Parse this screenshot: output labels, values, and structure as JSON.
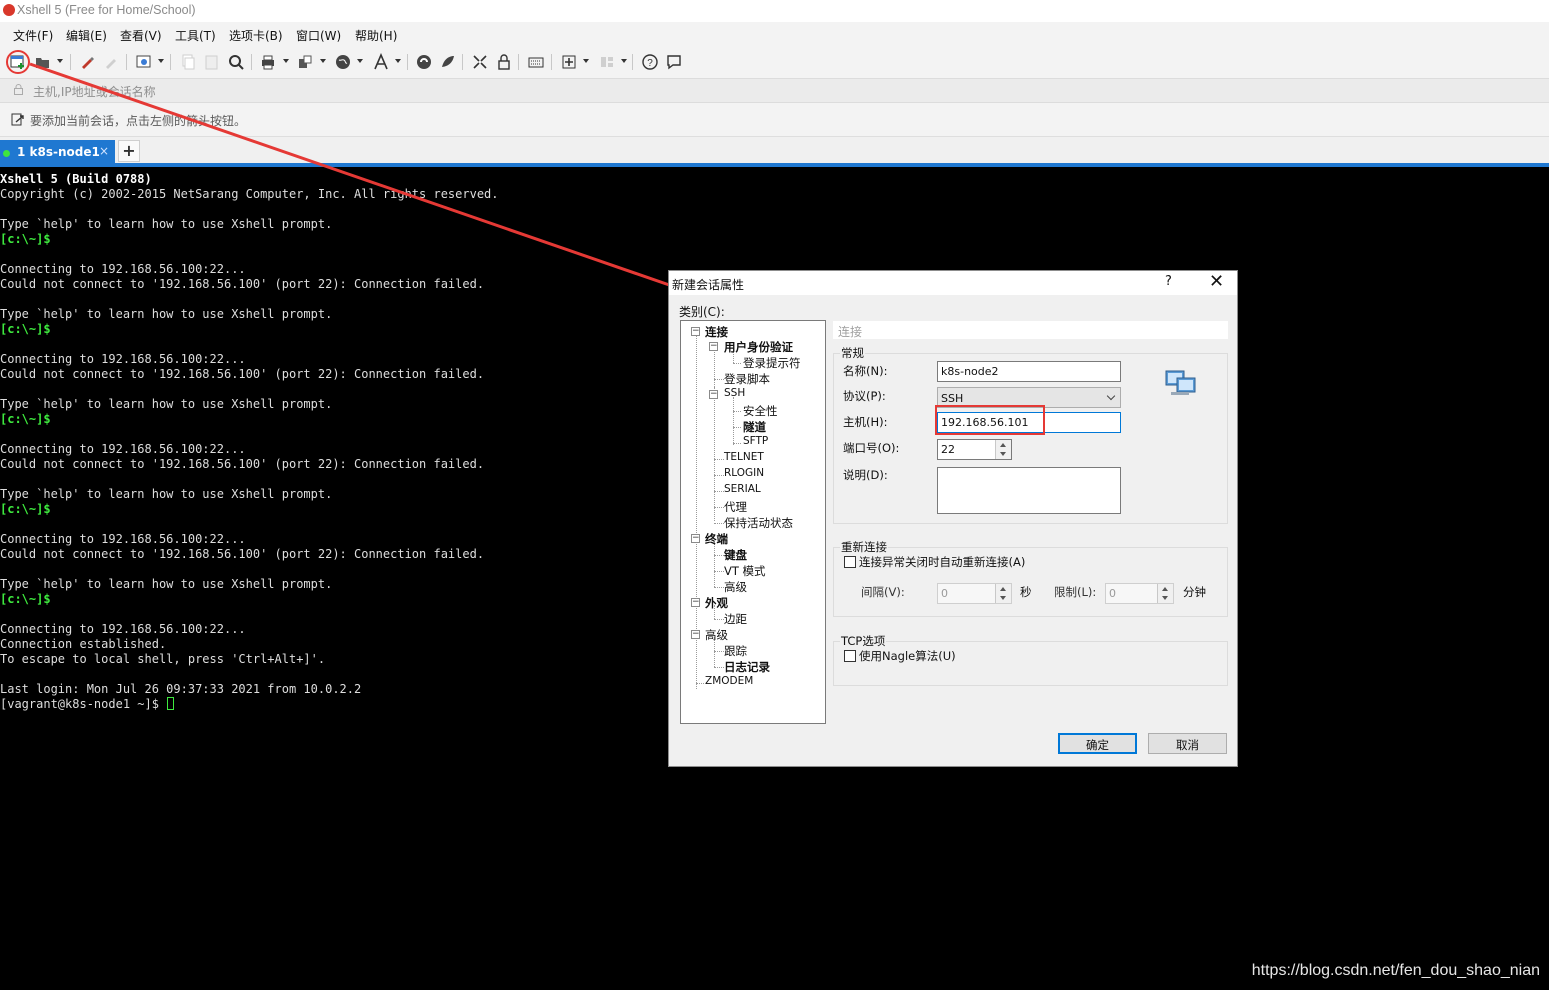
{
  "window": {
    "title": "Xshell 5 (Free for Home/School)"
  },
  "menu": [
    "文件(F)",
    "编辑(E)",
    "查看(V)",
    "工具(T)",
    "选项卡(B)",
    "窗口(W)",
    "帮助(H)"
  ],
  "toolbar": {
    "icons": [
      "new-session-icon",
      "open-folder-icon",
      "reconnect-icon",
      "disconnect-icon",
      "properties-icon",
      "copy-icon",
      "paste-icon",
      "find-icon",
      "print-icon",
      "transfer-icon",
      "globe-icon",
      "font-icon",
      "xftp-icon",
      "xmanager-icon",
      "fullscreen-icon",
      "lock-icon",
      "keyboard-icon",
      "add-tab-icon",
      "layout-icon",
      "help-icon",
      "chat-icon"
    ]
  },
  "address": {
    "placeholder": "主机,IP地址或会话名称"
  },
  "session_bar": {
    "hint": "要添加当前会话，点击左侧的箭头按钮。"
  },
  "tabs": [
    {
      "label": "1 k8s-node1",
      "close": "×",
      "status_color": "#3fe53f"
    }
  ],
  "add_tab": "+",
  "terminal": {
    "lines": [
      {
        "text": "Xshell 5 (Build 0788)",
        "style": "bold"
      },
      {
        "text": "Copyright (c) 2002-2015 NetSarang Computer, Inc. All rights reserved.",
        "style": "normal"
      },
      {
        "text": "",
        "style": "normal"
      },
      {
        "text": "Type `help' to learn how to use Xshell prompt.",
        "style": "normal"
      },
      {
        "text": "[c:\\~]$",
        "style": "prompt"
      },
      {
        "text": "",
        "style": "normal"
      },
      {
        "text": "Connecting to 192.168.56.100:22...",
        "style": "normal"
      },
      {
        "text": "Could not connect to '192.168.56.100' (port 22): Connection failed.",
        "style": "normal"
      },
      {
        "text": "",
        "style": "normal"
      },
      {
        "text": "Type `help' to learn how to use Xshell prompt.",
        "style": "normal"
      },
      {
        "text": "[c:\\~]$",
        "style": "prompt"
      },
      {
        "text": "",
        "style": "normal"
      },
      {
        "text": "Connecting to 192.168.56.100:22...",
        "style": "normal"
      },
      {
        "text": "Could not connect to '192.168.56.100' (port 22): Connection failed.",
        "style": "normal"
      },
      {
        "text": "",
        "style": "normal"
      },
      {
        "text": "Type `help' to learn how to use Xshell prompt.",
        "style": "normal"
      },
      {
        "text": "[c:\\~]$",
        "style": "prompt"
      },
      {
        "text": "",
        "style": "normal"
      },
      {
        "text": "Connecting to 192.168.56.100:22...",
        "style": "normal"
      },
      {
        "text": "Could not connect to '192.168.56.100' (port 22): Connection failed.",
        "style": "normal"
      },
      {
        "text": "",
        "style": "normal"
      },
      {
        "text": "Type `help' to learn how to use Xshell prompt.",
        "style": "normal"
      },
      {
        "text": "[c:\\~]$",
        "style": "prompt"
      },
      {
        "text": "",
        "style": "normal"
      },
      {
        "text": "Connecting to 192.168.56.100:22...",
        "style": "normal"
      },
      {
        "text": "Could not connect to '192.168.56.100' (port 22): Connection failed.",
        "style": "normal"
      },
      {
        "text": "",
        "style": "normal"
      },
      {
        "text": "Type `help' to learn how to use Xshell prompt.",
        "style": "normal"
      },
      {
        "text": "[c:\\~]$",
        "style": "prompt"
      },
      {
        "text": "",
        "style": "normal"
      },
      {
        "text": "Connecting to 192.168.56.100:22...",
        "style": "normal"
      },
      {
        "text": "Connection established.",
        "style": "normal"
      },
      {
        "text": "To escape to local shell, press 'Ctrl+Alt+]'.",
        "style": "normal"
      },
      {
        "text": "",
        "style": "normal"
      },
      {
        "text": "Last login: Mon Jul 26 09:37:33 2021 from 10.0.2.2",
        "style": "normal"
      }
    ],
    "prompt": "[vagrant@k8s-node1 ~]$ "
  },
  "watermark": "https://blog.csdn.net/fen_dou_shao_nian",
  "dialog": {
    "title": "新建会话属性",
    "help": "?",
    "close": "✕",
    "category_label": "类别(C):",
    "tree": {
      "connection": "连接",
      "auth": "用户身份验证",
      "login_prompt": "登录提示符",
      "login_script": "登录脚本",
      "ssh": "SSH",
      "security": "安全性",
      "tunnel": "隧道",
      "sftp": "SFTP",
      "telnet": "TELNET",
      "rlogin": "RLOGIN",
      "serial": "SERIAL",
      "proxy": "代理",
      "keepalive": "保持活动状态",
      "terminal": "终端",
      "keyboard": "键盘",
      "vt_mode": "VT 模式",
      "term_advanced": "高级",
      "appearance": "外观",
      "margin": "边距",
      "advanced": "高级",
      "trace": "跟踪",
      "logging": "日志记录",
      "zmodem": "ZMODEM"
    },
    "section_title": "连接",
    "general": {
      "label": "常规",
      "name_label": "名称(N):",
      "name_value": "k8s-node2",
      "protocol_label": "协议(P):",
      "protocol_value": "SSH",
      "host_label": "主机(H):",
      "host_value": "192.168.56.101",
      "port_label": "端口号(O):",
      "port_value": "22",
      "desc_label": "说明(D):",
      "desc_value": ""
    },
    "reconnect": {
      "label": "重新连接",
      "auto_reconnect": "连接异常关闭时自动重新连接(A)",
      "interval_label": "间隔(V):",
      "interval_value": "0",
      "interval_unit": "秒",
      "limit_label": "限制(L):",
      "limit_value": "0",
      "limit_unit": "分钟"
    },
    "tcp": {
      "label": "TCP选项",
      "nagle": "使用Nagle算法(U)"
    },
    "ok": "确定",
    "cancel": "取消"
  },
  "colors": {
    "accent": "#1f78d1",
    "annotation": "#e53935",
    "prompt_green": "#3ee93e"
  }
}
